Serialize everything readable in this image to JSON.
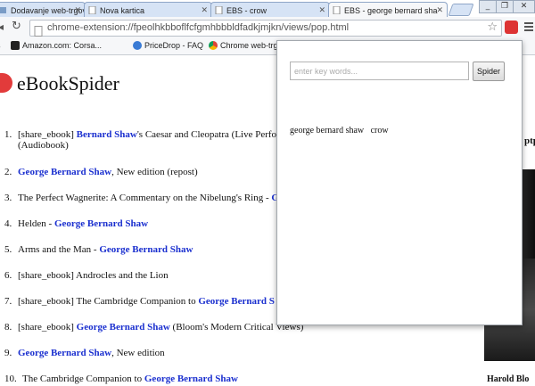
{
  "tabs": [
    {
      "label": "Dodavanje web-trgovina"
    },
    {
      "label": "Nova kartica"
    },
    {
      "label": "EBS - crow"
    },
    {
      "label": "EBS - george bernard sha"
    }
  ],
  "address": {
    "url": "chrome-extension://fpeolhkbboflfcfgmhbbbldfadkjmjkn/views/pop.html"
  },
  "bookmarks": [
    {
      "label": "Amazon.com: Corsa..."
    },
    {
      "label": "PriceDrop - FAQ"
    },
    {
      "label": "Chrome web-trgovi..."
    }
  ],
  "page": {
    "title": "eBookSpider",
    "results": [
      {
        "num": "1.",
        "prefix": "[share_ebook] ",
        "author": "Bernard Shaw",
        "suffix": "'s Caesar and Cleopatra (Live Perfo",
        "line2": "(Audiobook)"
      },
      {
        "num": "2.",
        "prefix": "",
        "author": "George Bernard Shaw",
        "suffix": ", New edition (repost)"
      },
      {
        "num": "3.",
        "prefix": "The Perfect Wagnerite: A Commentary on the Nibelung's Ring - ",
        "author": "G",
        "suffix": ""
      },
      {
        "num": "4.",
        "prefix": "Helden - ",
        "author": "George Bernard Shaw",
        "suffix": ""
      },
      {
        "num": "5.",
        "prefix": "Arms and the Man - ",
        "author": "George Bernard Shaw",
        "suffix": ""
      },
      {
        "num": "6.",
        "prefix": "[share_ebook] Androcles and the Lion",
        "author": "",
        "suffix": ""
      },
      {
        "num": "7.",
        "prefix": "[share_ebook] The Cambridge Companion to ",
        "author": "George Bernard S",
        "suffix": ""
      },
      {
        "num": "8.",
        "prefix": "[share_ebook] ",
        "author": "George Bernard Shaw",
        "suffix": " (Bloom's Modern Critical Views)"
      },
      {
        "num": "9.",
        "prefix": "",
        "author": "George Bernard Shaw",
        "suffix": ", New edition"
      },
      {
        "num": "10.",
        "prefix": "The Cambridge Companion to ",
        "author": "George Bernard Shaw",
        "suffix": ""
      }
    ],
    "sidebar_heading": "ptp",
    "sidebar_caption": "Harold Blo"
  },
  "popup": {
    "search_placeholder": "enter key words...",
    "spider_button": "Spider",
    "query_text": "george bernard shaw   crow"
  },
  "colors": {
    "link": "#1a2fcf",
    "logo": "#e23b3b"
  }
}
